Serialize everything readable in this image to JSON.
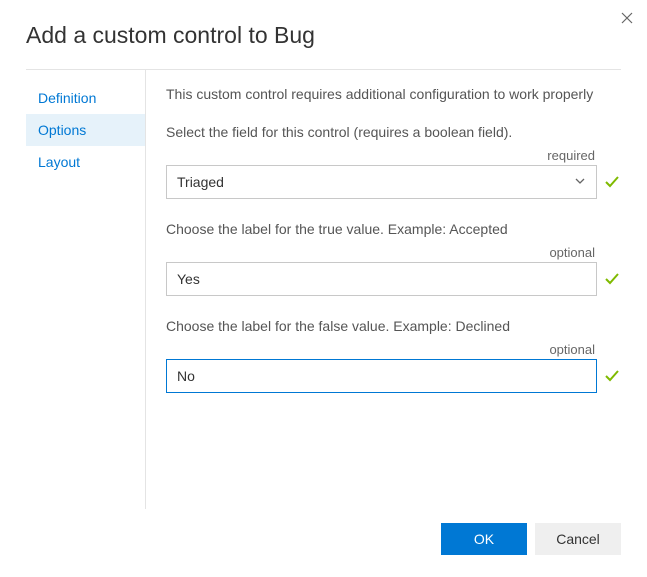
{
  "dialog": {
    "title": "Add a custom control to Bug"
  },
  "sidebar": {
    "items": [
      {
        "label": "Definition"
      },
      {
        "label": "Options"
      },
      {
        "label": "Layout"
      }
    ],
    "active_index": 1
  },
  "main": {
    "intro": "This custom control requires additional configuration to work properly",
    "fields": [
      {
        "label": "Select the field for this control (requires a boolean field).",
        "hint": "required",
        "type": "select",
        "value": "Triaged",
        "valid": true
      },
      {
        "label": "Choose the label for the true value. Example: Accepted",
        "hint": "optional",
        "type": "text",
        "value": "Yes",
        "valid": true
      },
      {
        "label": "Choose the label for the false value. Example: Declined",
        "hint": "optional",
        "type": "text",
        "value": "No",
        "valid": true,
        "focused": true
      }
    ]
  },
  "footer": {
    "ok": "OK",
    "cancel": "Cancel"
  }
}
